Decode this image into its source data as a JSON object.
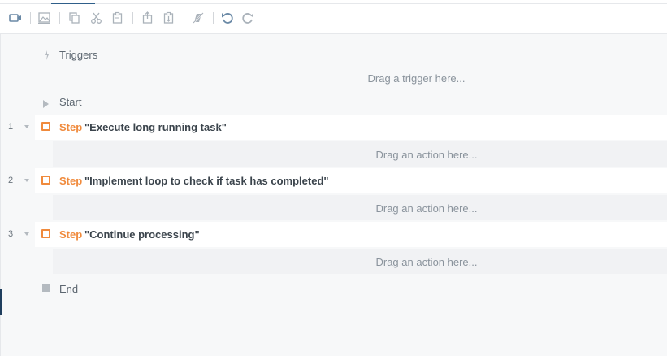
{
  "toolbar": {
    "icons": [
      "video-camera-icon",
      "image-icon",
      "copy-icon",
      "cut-icon",
      "paste-icon",
      "paste-before-icon",
      "paste-after-icon",
      "disable-icon",
      "undo-icon",
      "redo-icon"
    ]
  },
  "flow": {
    "triggers_label": "Triggers",
    "trigger_placeholder": "Drag a trigger here...",
    "start_label": "Start",
    "end_label": "End",
    "action_placeholder": "Drag an action here...",
    "steps": [
      {
        "number": "1",
        "keyword": "Step",
        "name": "\"Execute long running task\""
      },
      {
        "number": "2",
        "keyword": "Step",
        "name": "\"Implement loop to check if task has completed\""
      },
      {
        "number": "3",
        "keyword": "Step",
        "name": "\"Continue processing\""
      }
    ]
  },
  "colors": {
    "accent": "#f08a3c",
    "tab_accent": "#2f5f8a",
    "text": "#3b444c",
    "muted": "#8a939c"
  }
}
